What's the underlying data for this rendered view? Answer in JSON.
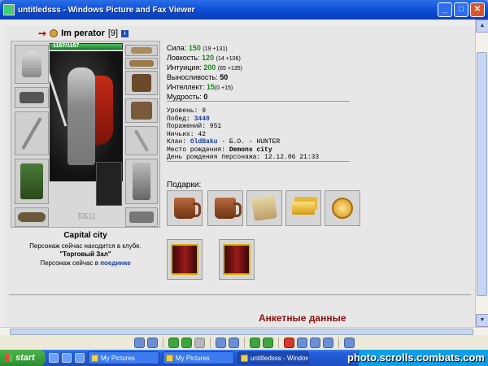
{
  "window": {
    "title": "untitledsss - Windows Picture and Fax Viewer",
    "minimize": "_",
    "maximize": "□",
    "close": "✕"
  },
  "character": {
    "name": "Im perator",
    "level_bracket": "[9]",
    "info_badge": "i",
    "hp_text": "1157/1157",
    "hp_fraction": 1.0,
    "emblem": "БКЦ",
    "city": "Capital city",
    "location_line1": "Персонаж сейчас находится в клубе.",
    "location_room": "\"Торговый Зал\"",
    "location_line3_prefix": "Персонаж сейчас в",
    "location_line3_link": "поединке"
  },
  "stats": [
    {
      "label": "Сила:",
      "value": "150",
      "mod": "(19 +131)",
      "color": "green"
    },
    {
      "label": "Ловкость:",
      "value": "120",
      "mod": "(14 +106)",
      "color": "green"
    },
    {
      "label": "Интуиция:",
      "value": "200",
      "mod": "(65 +135)",
      "color": "green"
    },
    {
      "label": "Выносливость:",
      "value": "50",
      "mod": "",
      "color": "black"
    },
    {
      "label": "Интеллект:",
      "value": "15",
      "mod": "(0 +15)",
      "color": "green"
    },
    {
      "label": "Мудрость:",
      "value": "0",
      "mod": "",
      "color": "black"
    }
  ],
  "info": {
    "level": "Уровень: 9",
    "wins_label": "Побед: ",
    "wins_value": "3440",
    "losses": "Поражений: 951",
    "draws": "Ничьих: 42",
    "clan_label": "Клан: ",
    "clan_name": "OldBaku",
    "clan_rest": " - Б.О. - HUNTER",
    "birthplace_label": "Место рождения: ",
    "birthplace_value": "Demons city",
    "birthday": "День рождения персонажа: 12.12.06 21:33"
  },
  "gifts_label": "Подарки:",
  "bottom_heading": "Анкетные данные",
  "taskbar": {
    "start": "start",
    "tasks": [
      "My Pictures",
      "My Pictures",
      "untitledsss - Windows..."
    ]
  },
  "watermark": "photo.scrolls.combats.com"
}
